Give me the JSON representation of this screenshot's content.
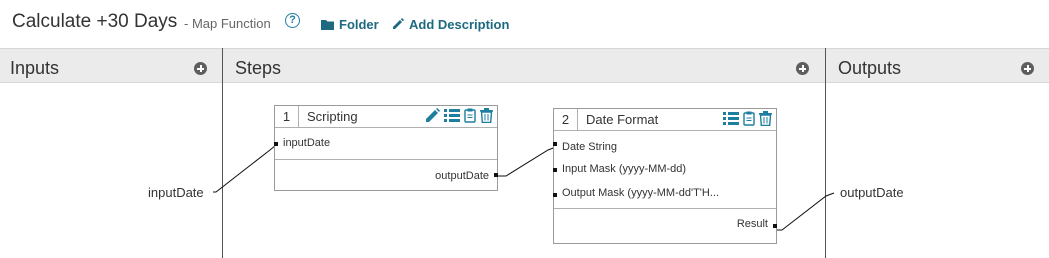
{
  "header": {
    "title": "Calculate +30 Days",
    "subtitle": "- Map Function",
    "help_icon": "?",
    "folder_label": "Folder",
    "add_description_label": "Add Description"
  },
  "columns": {
    "inputs": "Inputs",
    "steps": "Steps",
    "outputs": "Outputs"
  },
  "inputs": [
    {
      "name": "inputDate"
    }
  ],
  "outputs": [
    {
      "name": "outputDate"
    }
  ],
  "steps": [
    {
      "number": "1",
      "name": "Scripting",
      "tools": [
        "edit-icon",
        "list-icon",
        "copy-icon",
        "delete-icon"
      ],
      "inputs": [
        "inputDate"
      ],
      "outputs": [
        "outputDate"
      ]
    },
    {
      "number": "2",
      "name": "Date Format",
      "tools": [
        "list-icon",
        "copy-icon",
        "delete-icon"
      ],
      "inputs": [
        "Date String",
        "Input Mask (yyyy-MM-dd)",
        "Output Mask (yyyy-MM-dd'T'H..."
      ],
      "outputs": [
        "Result"
      ]
    }
  ],
  "colors": {
    "accent": "#1d6a80",
    "tool_icon": "#1d7ea0",
    "band": "#ebebeb",
    "plus_icon": "#5e5e5e"
  }
}
